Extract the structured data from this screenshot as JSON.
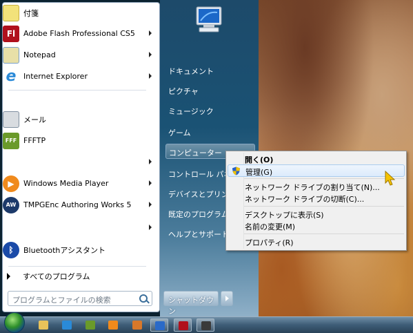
{
  "colors": {
    "accent": "#1a5274",
    "hover": "#dcebfc"
  },
  "start_menu": {
    "pinned": [
      {
        "label": "付箋",
        "icon": "sticky-notes-icon",
        "color": "#f2e27a",
        "arrow": false
      },
      {
        "label": "Adobe Flash Professional CS5",
        "icon": "adobe-flash-icon",
        "color": "#b0101c",
        "arrow": true
      },
      {
        "label": "Notepad",
        "icon": "notepad-icon",
        "color": "#e8e0a8",
        "arrow": true
      },
      {
        "label": "Internet Explorer",
        "icon": "internet-explorer-icon",
        "color": "#2a8ad8",
        "arrow": true
      }
    ],
    "recent": [
      {
        "label": "メール",
        "icon": "mail-icon",
        "color": "#d8dce0",
        "arrow": false
      },
      {
        "label": "FFFTP",
        "icon": "ffftp-icon",
        "color": "#6a9a2a",
        "arrow": false
      },
      {
        "label": "",
        "icon": "blank-icon",
        "color": "",
        "arrow": true
      },
      {
        "label": "Windows Media Player",
        "icon": "media-player-icon",
        "color": "#f08a1c",
        "arrow": true
      },
      {
        "label": "TMPGEnc Authoring Works 5",
        "icon": "tmpgenc-icon",
        "color": "#1c3a6a",
        "arrow": true
      },
      {
        "label": "",
        "icon": "blank-icon",
        "color": "",
        "arrow": true
      },
      {
        "label": "Bluetoothアシスタント",
        "icon": "bluetooth-icon",
        "color": "#1a4aa8",
        "arrow": false
      }
    ],
    "all_programs": "すべてのプログラム",
    "search_placeholder": "プログラムとファイルの検索",
    "right_items": {
      "documents": "ドキュメント",
      "pictures": "ピクチャ",
      "music": "ミュージック",
      "games": "ゲーム",
      "computer": "コンピューター",
      "control_panel": "コントロール パネ",
      "devices": "デバイスとプリンタ",
      "default_programs": "既定のプログラム",
      "help": "ヘルプとサポート"
    },
    "shutdown": "シャットダウン"
  },
  "context_menu": {
    "open": "開く(O)",
    "manage": "管理(G)",
    "map_drive": "ネットワーク ドライブの割り当て(N)...",
    "disconnect_drive": "ネットワーク ドライブの切断(C)...",
    "show_desktop": "デスクトップに表示(S)",
    "rename": "名前の変更(M)",
    "properties": "プロパティ(R)"
  },
  "taskbar": {
    "apps": [
      {
        "icon": "explorer-folder-icon",
        "active": false,
        "color": "#e8c25a"
      },
      {
        "icon": "internet-explorer-icon",
        "active": false,
        "color": "#2a8ad8"
      },
      {
        "icon": "ffftp-icon",
        "active": false,
        "color": "#6a9a2a"
      },
      {
        "icon": "media-player-icon",
        "active": false,
        "color": "#f08a1c"
      },
      {
        "icon": "image-viewer-icon",
        "active": false,
        "color": "#d8782a"
      },
      {
        "icon": "network-download-icon",
        "active": true,
        "color": "#2a6ac8"
      },
      {
        "icon": "adobe-flash-icon",
        "active": true,
        "color": "#b0101c"
      },
      {
        "icon": "screenshot-tool-icon",
        "active": true,
        "color": "#3a3a3a"
      }
    ]
  }
}
